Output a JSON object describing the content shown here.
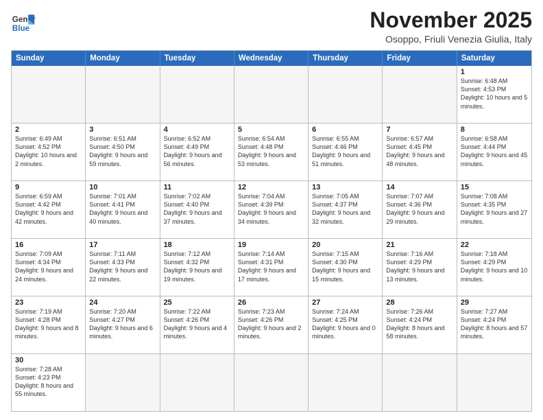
{
  "logo": {
    "line1": "General",
    "line2": "Blue"
  },
  "title": "November 2025",
  "subtitle": "Osoppo, Friuli Venezia Giulia, Italy",
  "headers": [
    "Sunday",
    "Monday",
    "Tuesday",
    "Wednesday",
    "Thursday",
    "Friday",
    "Saturday"
  ],
  "weeks": [
    [
      {
        "day": "",
        "empty": true
      },
      {
        "day": "",
        "empty": true
      },
      {
        "day": "",
        "empty": true
      },
      {
        "day": "",
        "empty": true
      },
      {
        "day": "",
        "empty": true
      },
      {
        "day": "",
        "empty": true
      },
      {
        "day": "1",
        "info": "Sunrise: 6:48 AM\nSunset: 4:53 PM\nDaylight: 10 hours and 5 minutes."
      }
    ],
    [
      {
        "day": "2",
        "info": "Sunrise: 6:49 AM\nSunset: 4:52 PM\nDaylight: 10 hours and 2 minutes."
      },
      {
        "day": "3",
        "info": "Sunrise: 6:51 AM\nSunset: 4:50 PM\nDaylight: 9 hours and 59 minutes."
      },
      {
        "day": "4",
        "info": "Sunrise: 6:52 AM\nSunset: 4:49 PM\nDaylight: 9 hours and 56 minutes."
      },
      {
        "day": "5",
        "info": "Sunrise: 6:54 AM\nSunset: 4:48 PM\nDaylight: 9 hours and 53 minutes."
      },
      {
        "day": "6",
        "info": "Sunrise: 6:55 AM\nSunset: 4:46 PM\nDaylight: 9 hours and 51 minutes."
      },
      {
        "day": "7",
        "info": "Sunrise: 6:57 AM\nSunset: 4:45 PM\nDaylight: 9 hours and 48 minutes."
      },
      {
        "day": "8",
        "info": "Sunrise: 6:58 AM\nSunset: 4:44 PM\nDaylight: 9 hours and 45 minutes."
      }
    ],
    [
      {
        "day": "9",
        "info": "Sunrise: 6:59 AM\nSunset: 4:42 PM\nDaylight: 9 hours and 42 minutes."
      },
      {
        "day": "10",
        "info": "Sunrise: 7:01 AM\nSunset: 4:41 PM\nDaylight: 9 hours and 40 minutes."
      },
      {
        "day": "11",
        "info": "Sunrise: 7:02 AM\nSunset: 4:40 PM\nDaylight: 9 hours and 37 minutes."
      },
      {
        "day": "12",
        "info": "Sunrise: 7:04 AM\nSunset: 4:39 PM\nDaylight: 9 hours and 34 minutes."
      },
      {
        "day": "13",
        "info": "Sunrise: 7:05 AM\nSunset: 4:37 PM\nDaylight: 9 hours and 32 minutes."
      },
      {
        "day": "14",
        "info": "Sunrise: 7:07 AM\nSunset: 4:36 PM\nDaylight: 9 hours and 29 minutes."
      },
      {
        "day": "15",
        "info": "Sunrise: 7:08 AM\nSunset: 4:35 PM\nDaylight: 9 hours and 27 minutes."
      }
    ],
    [
      {
        "day": "16",
        "info": "Sunrise: 7:09 AM\nSunset: 4:34 PM\nDaylight: 9 hours and 24 minutes."
      },
      {
        "day": "17",
        "info": "Sunrise: 7:11 AM\nSunset: 4:33 PM\nDaylight: 9 hours and 22 minutes."
      },
      {
        "day": "18",
        "info": "Sunrise: 7:12 AM\nSunset: 4:32 PM\nDaylight: 9 hours and 19 minutes."
      },
      {
        "day": "19",
        "info": "Sunrise: 7:14 AM\nSunset: 4:31 PM\nDaylight: 9 hours and 17 minutes."
      },
      {
        "day": "20",
        "info": "Sunrise: 7:15 AM\nSunset: 4:30 PM\nDaylight: 9 hours and 15 minutes."
      },
      {
        "day": "21",
        "info": "Sunrise: 7:16 AM\nSunset: 4:29 PM\nDaylight: 9 hours and 13 minutes."
      },
      {
        "day": "22",
        "info": "Sunrise: 7:18 AM\nSunset: 4:29 PM\nDaylight: 9 hours and 10 minutes."
      }
    ],
    [
      {
        "day": "23",
        "info": "Sunrise: 7:19 AM\nSunset: 4:28 PM\nDaylight: 9 hours and 8 minutes."
      },
      {
        "day": "24",
        "info": "Sunrise: 7:20 AM\nSunset: 4:27 PM\nDaylight: 9 hours and 6 minutes."
      },
      {
        "day": "25",
        "info": "Sunrise: 7:22 AM\nSunset: 4:26 PM\nDaylight: 9 hours and 4 minutes."
      },
      {
        "day": "26",
        "info": "Sunrise: 7:23 AM\nSunset: 4:26 PM\nDaylight: 9 hours and 2 minutes."
      },
      {
        "day": "27",
        "info": "Sunrise: 7:24 AM\nSunset: 4:25 PM\nDaylight: 9 hours and 0 minutes."
      },
      {
        "day": "28",
        "info": "Sunrise: 7:26 AM\nSunset: 4:24 PM\nDaylight: 8 hours and 58 minutes."
      },
      {
        "day": "29",
        "info": "Sunrise: 7:27 AM\nSunset: 4:24 PM\nDaylight: 8 hours and 57 minutes."
      }
    ],
    [
      {
        "day": "30",
        "info": "Sunrise: 7:28 AM\nSunset: 4:23 PM\nDaylight: 8 hours and 55 minutes."
      },
      {
        "day": "",
        "empty": true
      },
      {
        "day": "",
        "empty": true
      },
      {
        "day": "",
        "empty": true
      },
      {
        "day": "",
        "empty": true
      },
      {
        "day": "",
        "empty": true
      },
      {
        "day": "",
        "empty": true
      }
    ]
  ]
}
